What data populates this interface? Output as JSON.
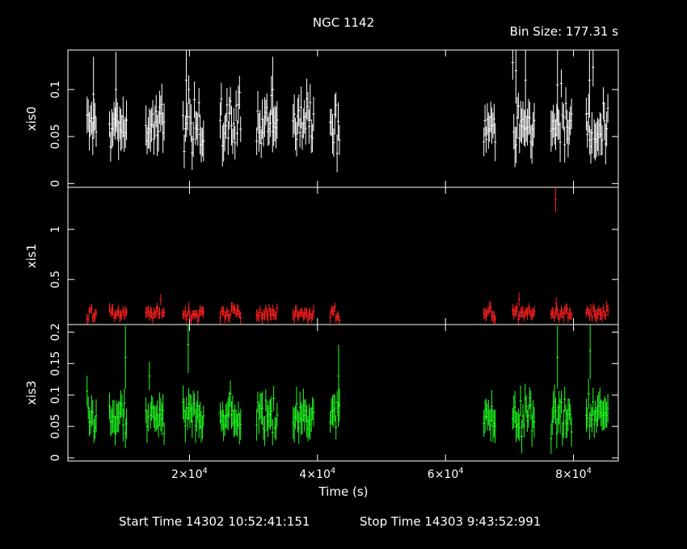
{
  "title": "NGC 1142",
  "bin_size": "Bin Size: 177.31 s",
  "start_time": "Start Time 14302 10:52:41:151",
  "stop_time": "Stop Time 14303  9:43:52:991",
  "colors": {
    "background": "#000000",
    "frame": "#ffffff",
    "xis0": "#ffffff",
    "xis1": "#ff2020",
    "xis3": "#20ff20"
  },
  "chart_data": {
    "type": "scatter",
    "xlabel": "Time (s)",
    "xlim": [
      1000,
      87000
    ],
    "x_ticks": [
      {
        "value": 20000,
        "label": "2×10",
        "exp": "4"
      },
      {
        "value": 40000,
        "label": "4×10",
        "exp": "4"
      },
      {
        "value": 60000,
        "label": "6×10",
        "exp": "4"
      },
      {
        "value": 80000,
        "label": "8×10",
        "exp": "4"
      }
    ],
    "error_bars": true,
    "segments": [
      [
        4000,
        5500
      ],
      [
        7500,
        10300
      ],
      [
        13200,
        16200
      ],
      [
        19000,
        22300
      ],
      [
        24800,
        28000
      ],
      [
        30500,
        33800
      ],
      [
        36200,
        39500
      ],
      [
        42000,
        43500
      ],
      [
        66000,
        67800
      ],
      [
        70500,
        74000
      ],
      [
        76500,
        79800
      ],
      [
        82000,
        85500
      ]
    ],
    "panels": [
      {
        "name": "xis0",
        "ylabel": "xis0",
        "color": "#ffffff",
        "ylim": [
          -0.004,
          0.142
        ],
        "y_ticks": [
          {
            "value": 0,
            "label": "0"
          },
          {
            "value": 0.05,
            "label": "0.05"
          },
          {
            "value": 0.1,
            "label": "0.1"
          }
        ],
        "typical": 0.06,
        "spread": 0.013,
        "err": 0.018,
        "spikes": [
          {
            "x": 5000,
            "y": 0.095,
            "err": 0.04
          },
          {
            "x": 8500,
            "y": 0.1,
            "err": 0.04
          },
          {
            "x": 19500,
            "y": 0.11,
            "err": 0.04
          },
          {
            "x": 33000,
            "y": 0.1,
            "err": 0.035
          },
          {
            "x": 71000,
            "y": 0.12,
            "err": 0.035
          },
          {
            "x": 72500,
            "y": 0.11,
            "err": 0.04
          },
          {
            "x": 77500,
            "y": 0.105,
            "err": 0.04
          },
          {
            "x": 82500,
            "y": 0.11,
            "err": 0.04
          }
        ]
      },
      {
        "name": "xis1",
        "ylabel": "xis1",
        "color": "#ff2020",
        "ylim": [
          0.05,
          1.42
        ],
        "y_ticks": [
          {
            "value": 0.5,
            "label": "0.5"
          },
          {
            "value": 1,
            "label": "1"
          }
        ],
        "typical": 0.16,
        "spread": 0.03,
        "err": 0.05,
        "spikes": [
          {
            "x": 71500,
            "y": 0.3,
            "err": 0.07
          },
          {
            "x": 77200,
            "y": 1.3,
            "err": 0.13
          },
          {
            "x": 77300,
            "y": 0.26,
            "err": 0.06
          }
        ]
      },
      {
        "name": "xis3",
        "ylabel": "xis3",
        "color": "#20ff20",
        "ylim": [
          -0.005,
          0.212
        ],
        "y_ticks": [
          {
            "value": 0,
            "label": "0"
          },
          {
            "value": 0.05,
            "label": "0.05"
          },
          {
            "value": 0.1,
            "label": "0.1"
          },
          {
            "value": 0.15,
            "label": "0.15"
          },
          {
            "value": 0.2,
            "label": "0.2"
          }
        ],
        "typical": 0.065,
        "spread": 0.015,
        "err": 0.022,
        "spikes": [
          {
            "x": 10000,
            "y": 0.16,
            "err": 0.05
          },
          {
            "x": 19800,
            "y": 0.18,
            "err": 0.045
          },
          {
            "x": 43300,
            "y": 0.13,
            "err": 0.05
          },
          {
            "x": 77500,
            "y": 0.16,
            "err": 0.05
          },
          {
            "x": 82600,
            "y": 0.17,
            "err": 0.045
          }
        ]
      }
    ]
  }
}
